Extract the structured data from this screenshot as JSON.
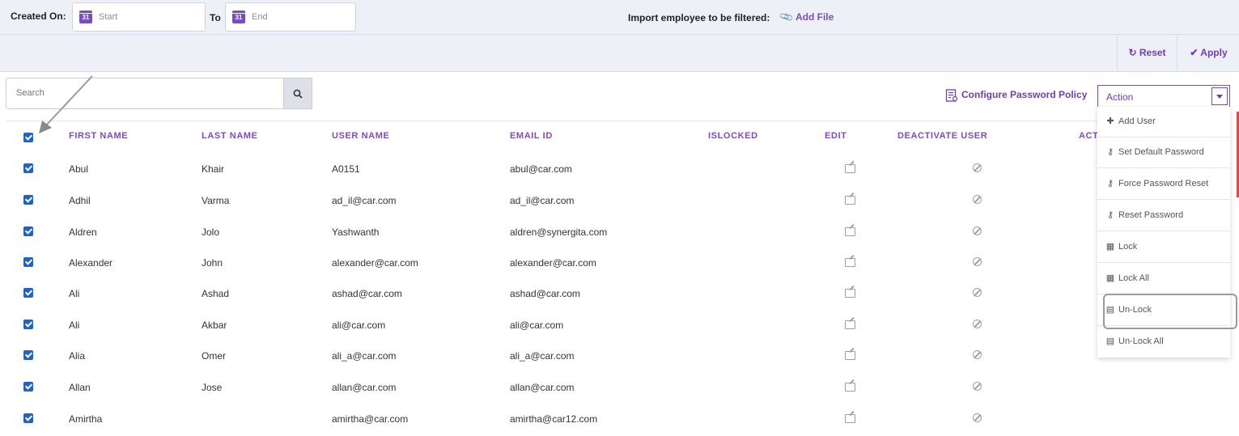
{
  "filters": {
    "created_on_label": "Created On:",
    "start_placeholder": "Start",
    "to_label": "To",
    "end_placeholder": "End",
    "calendar_day": "31",
    "import_label": "Import employee to be filtered:",
    "add_file_label": "Add File",
    "reset_label": "Reset",
    "apply_label": "Apply"
  },
  "toolbar": {
    "search_placeholder": "Search",
    "configure_label": "Configure Password Policy",
    "action_label": "Action"
  },
  "table": {
    "columns": [
      "FIRST NAME",
      "LAST NAME",
      "USER NAME",
      "EMAIL ID",
      "ISLOCKED",
      "EDIT",
      "DEACTIVATE USER",
      "ACTIONS"
    ],
    "rows": [
      {
        "first": "Abul",
        "last": "Khair",
        "user": "A0151",
        "email": "abul@car.com"
      },
      {
        "first": "Adhil",
        "last": "Varma",
        "user": "ad_il@car.com",
        "email": "ad_il@car.com"
      },
      {
        "first": "Aldren",
        "last": "Jolo",
        "user": "Yashwanth",
        "email": "aldren@synergita.com"
      },
      {
        "first": "Alexander",
        "last": "John",
        "user": "alexander@car.com",
        "email": "alexander@car.com"
      },
      {
        "first": "Ali",
        "last": "Ashad",
        "user": "ashad@car.com",
        "email": "ashad@car.com"
      },
      {
        "first": "Ali",
        "last": "Akbar",
        "user": "ali@car.com",
        "email": "ali@car.com"
      },
      {
        "first": "Alia",
        "last": "Omer",
        "user": "ali_a@car.com",
        "email": "ali_a@car.com"
      },
      {
        "first": "Allan",
        "last": "Jose",
        "user": "allan@car.com",
        "email": "allan@car.com"
      },
      {
        "first": "Amirtha",
        "last": "",
        "user": "amirtha@car.com",
        "email": "amirtha@car12.com"
      }
    ]
  },
  "action_menu": [
    {
      "label": "Add User",
      "icon": "plus-icon"
    },
    {
      "label": "Set Default Password",
      "icon": "key-icon"
    },
    {
      "label": "Force Password Reset",
      "icon": "key-icon"
    },
    {
      "label": "Reset Password",
      "icon": "key-icon"
    },
    {
      "label": "Lock",
      "icon": "lock-icon"
    },
    {
      "label": "Lock All",
      "icon": "lock-icon"
    },
    {
      "label": "Un-Lock",
      "icon": "unlock-icon"
    },
    {
      "label": "Un-Lock All",
      "icon": "unlock-icon"
    }
  ]
}
